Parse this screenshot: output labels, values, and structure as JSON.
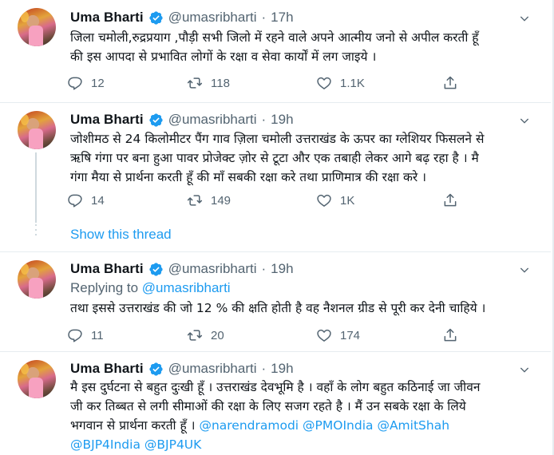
{
  "tweets": [
    {
      "name": "Uma Bharti",
      "handle": "@umasribharti",
      "separator": "·",
      "time": "17h",
      "lines": [
        "जिला चमोली,रुद्रप्रयाग ,पौड़ी सभी जिलो में रहने वाले अपने आत्मीय जनो से अपील करती हूँ",
        "की इस आपदा से प्रभावित लोगों के रक्षा व सेवा कार्यों में लग जाइये ।"
      ],
      "replies": "12",
      "retweets": "118",
      "likes": "1.1K"
    },
    {
      "name": "Uma Bharti",
      "handle": "@umasribharti",
      "separator": "·",
      "time": "19h",
      "lines": [
        "जोशीमठ से 24 किलोमीटर पैंग गाव ज़िला चमोली उत्तराखंड के ऊपर का ग्लेशियर फिसलने से",
        "ऋषि गंगा पर बना हुआ पावर प्रोजेक्ट ज़ोर से टूटा और एक तबाही लेकर आगे बढ़ रहा है । मै",
        "गंगा मैया से प्रार्थना करती हूँ की माँ सबकी रक्षा करे तथा प्राणिमात्र की रक्षा करे ।"
      ],
      "replies": "14",
      "retweets": "149",
      "likes": "1K",
      "show_thread": "Show this thread"
    },
    {
      "name": "Uma Bharti",
      "handle": "@umasribharti",
      "separator": "·",
      "time": "19h",
      "replying_prefix": "Replying to ",
      "replying_to": "@umasribharti",
      "lines": [
        "तथा इससे उत्तराखंड की जो 12 % की क्षति होती है वह नैशनल ग्रीड से पूरी कर देनी चाहिये ।"
      ],
      "replies": "11",
      "retweets": "20",
      "likes": "174"
    },
    {
      "name": "Uma Bharti",
      "handle": "@umasribharti",
      "separator": "·",
      "time": "19h",
      "lines": [
        "मै इस दुर्घटना से बहुत दुःखी हूँ । उत्तराखंड देवभूमि है । वहाँ के लोग बहुत कठिनाई जा जीवन",
        "जी कर तिब्बत से लगी सीमाओं की रक्षा के लिए सजग रहते है । मैं उन सबके रक्षा के लिये"
      ],
      "line3_text": "भगवान से प्रार्थना करती हूँ । ",
      "mentions_line3": [
        "@narendramodi",
        "@PMOIndia",
        "@AmitShah"
      ],
      "mentions_line4": [
        "@BJP4India",
        "@BJP4UK"
      ]
    }
  ],
  "icons": {
    "reply": "reply-icon",
    "retweet": "retweet-icon",
    "like": "heart-icon",
    "share": "share-icon",
    "more": "chevron-down-icon",
    "verified": "verified-badge-icon"
  },
  "colors": {
    "accent": "#1d9bf0",
    "text": "#0f1419",
    "muted": "#536471",
    "divider": "#e6ecf0"
  }
}
